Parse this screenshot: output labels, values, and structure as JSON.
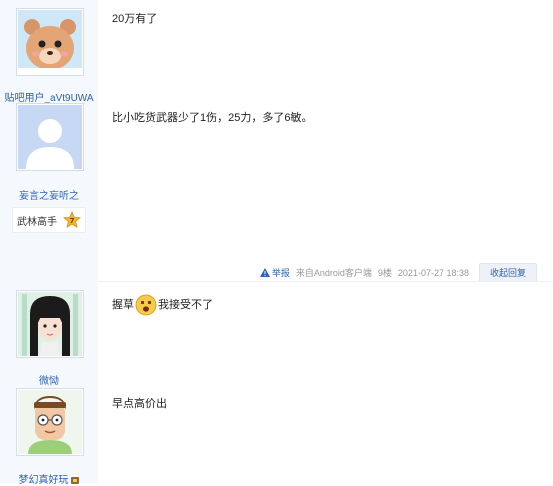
{
  "posts": [
    {
      "username": "贴吧用户_aVt9UWA",
      "text": "20万有了",
      "avatar": "bear-avatar-icon"
    },
    {
      "username": "妄言之妄听之",
      "text": "比小吃货武器少了1伤，25力，多了6敏。",
      "avatar": "default-avatar-icon",
      "badge": {
        "title": "武林高手",
        "level": "7"
      },
      "tail": {
        "report": "举报",
        "source": "来自Android客户端",
        "floor": "9楼",
        "time": "2021-07-27 18:38",
        "reply": "收起回复"
      }
    },
    {
      "username": "微恸",
      "text_before": "握草",
      "text_after": "我接受不了",
      "emoji": "shocked-face-icon",
      "avatar": "anime-girl-avatar-icon"
    },
    {
      "username": "梦幻真好玩",
      "text": "早点高价出",
      "avatar": "cartoon-man-avatar-icon"
    }
  ],
  "colors": {
    "link": "#2d64b3",
    "sidebar_bg": "#f5f8fd",
    "muted": "#999999"
  }
}
